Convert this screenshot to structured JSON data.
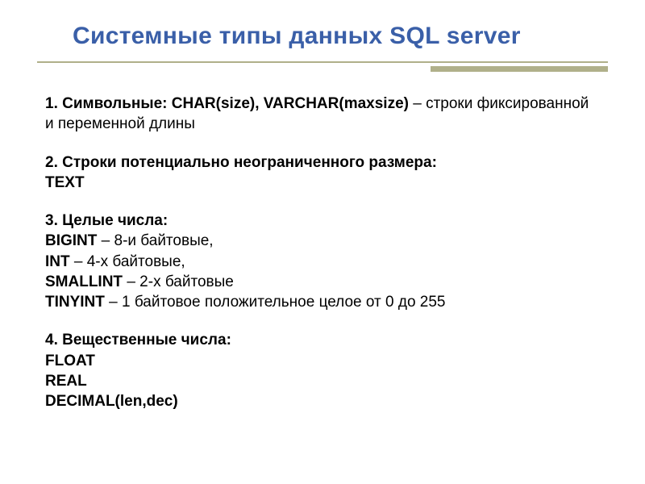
{
  "title": "Системные типы данных SQL server",
  "sections": {
    "s1": {
      "num": "1. ",
      "head": "Символьные: CHAR(size), VARCHAR(maxsize)",
      "tail": " – строки фиксированной и переменной длины"
    },
    "s2": {
      "num": "2. ",
      "head": "Строки потенциально неограниченного размера:",
      "line1": "TEXT"
    },
    "s3": {
      "num": "3. ",
      "head": "Целые числа:",
      "bigint_k": "BIGINT",
      "bigint_v": " – 8-и байтовые,",
      "int_k": "INT",
      "int_v": " – 4-х байтовые,",
      "smallint_k": "SMALLINT",
      "smallint_v": " – 2-х байтовые",
      "tinyint_k": "TINYINT",
      "tinyint_v": " – 1 байтовое положительное целое от 0 до 255"
    },
    "s4": {
      "num": "4. ",
      "head": "Вещественные числа:",
      "float": "FLOAT",
      "real": "REAL",
      "decimal": "DECIMAL(len,dec)"
    }
  }
}
